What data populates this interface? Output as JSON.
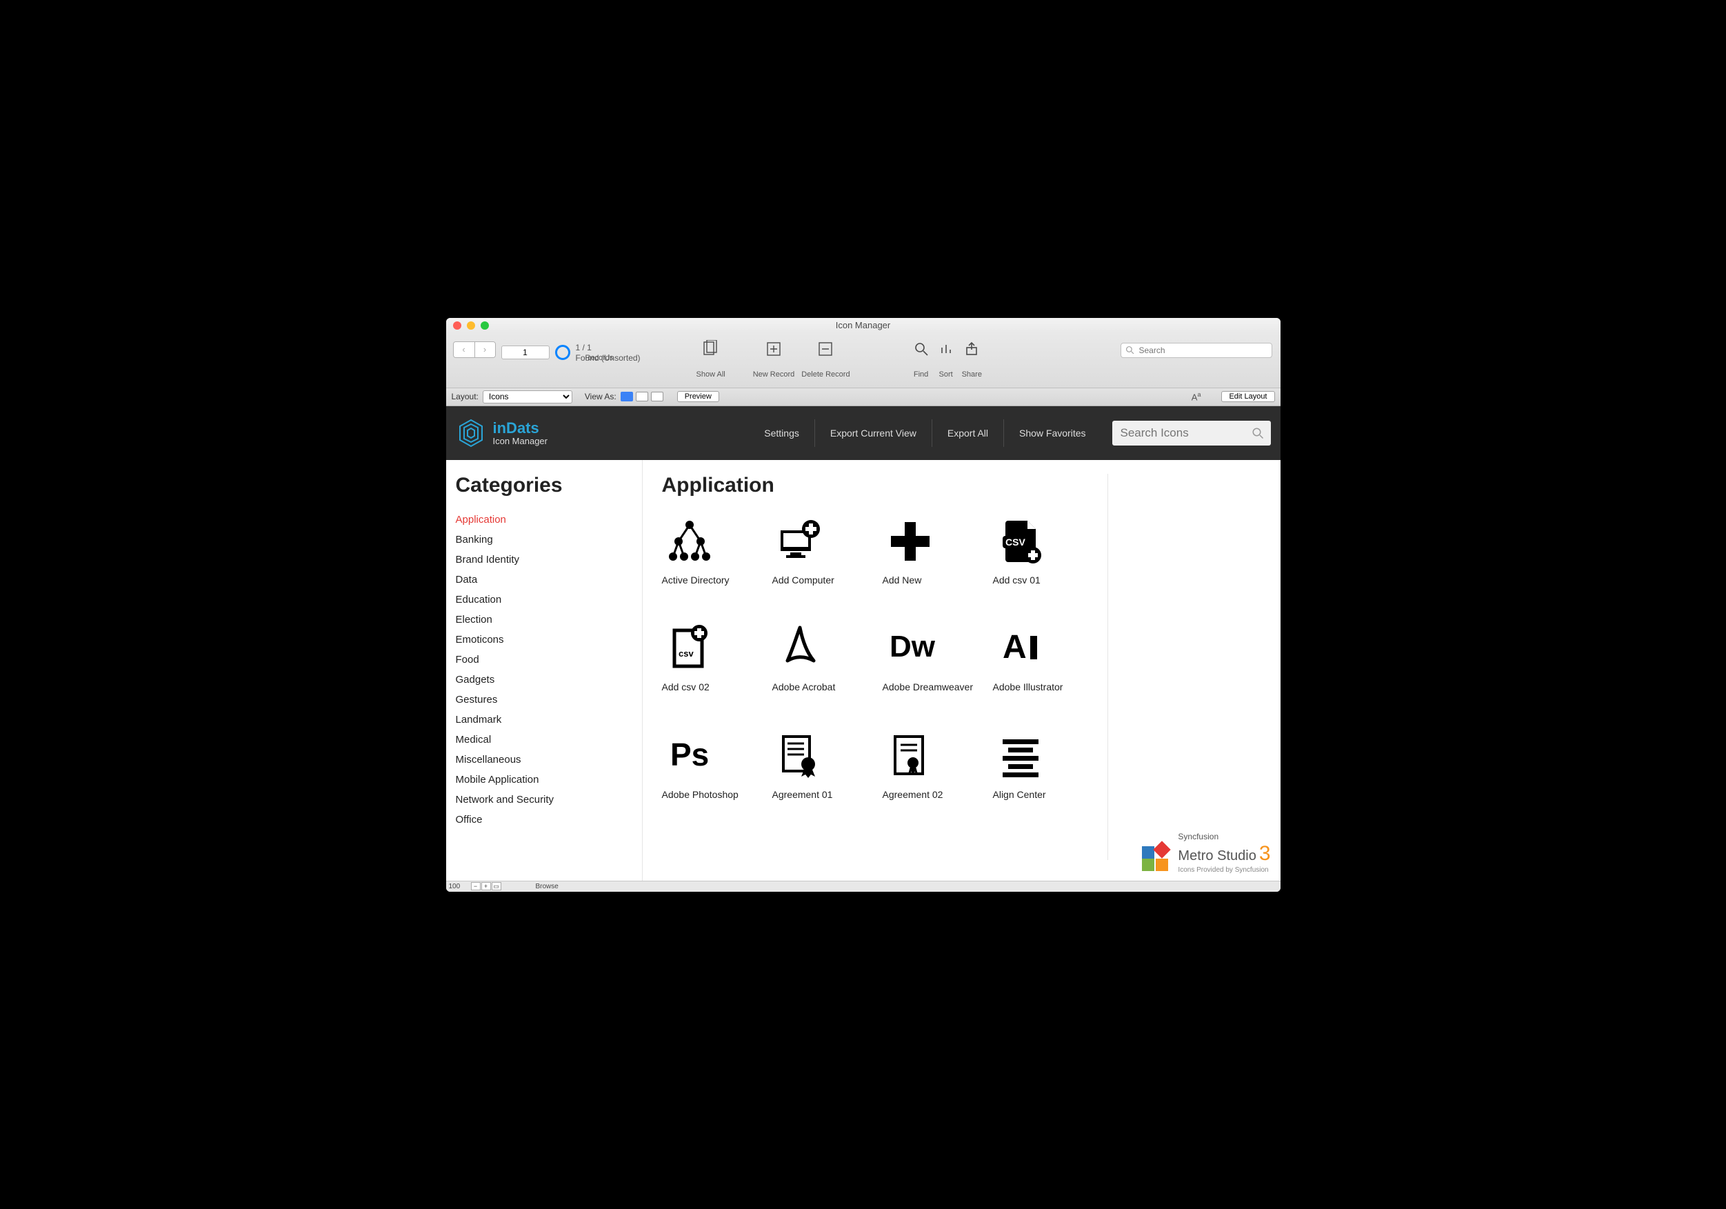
{
  "window": {
    "title": "Icon Manager"
  },
  "toolbar": {
    "record_number": "1",
    "found_count": "1 / 1",
    "found_label": "Found (Unsorted)",
    "records_label": "Records",
    "show_all": "Show All",
    "new_record": "New Record",
    "delete_record": "Delete Record",
    "find": "Find",
    "sort": "Sort",
    "share": "Share",
    "search_placeholder": "Search"
  },
  "layoutbar": {
    "layout_label": "Layout:",
    "layout_value": "Icons",
    "view_as": "View As:",
    "preview": "Preview",
    "edit_layout": "Edit Layout"
  },
  "darkbar": {
    "brand": "inDats",
    "sub": "Icon Manager",
    "links": [
      "Settings",
      "Export Current View",
      "Export All",
      "Show Favorites"
    ],
    "search_placeholder": "Search Icons"
  },
  "sidebar": {
    "heading": "Categories",
    "items": [
      "Application",
      "Banking",
      "Brand Identity",
      "Data",
      "Education",
      "Election",
      "Emoticons",
      "Food",
      "Gadgets",
      "Gestures",
      "Landmark",
      "Medical",
      "Miscellaneous",
      "Mobile Application",
      "Network and Security",
      "Office"
    ],
    "active_index": 0
  },
  "main": {
    "heading": "Application",
    "icons": [
      {
        "label": "Active Directory",
        "glyph": "tree"
      },
      {
        "label": "Add Computer",
        "glyph": "add-computer"
      },
      {
        "label": "Add New",
        "glyph": "plus"
      },
      {
        "label": "Add csv 01",
        "glyph": "csv-badge"
      },
      {
        "label": "Add csv 02",
        "glyph": "csv-page"
      },
      {
        "label": "Adobe Acrobat",
        "glyph": "acrobat"
      },
      {
        "label": "Adobe Dreamweaver",
        "glyph": "dw"
      },
      {
        "label": "Adobe Illustrator",
        "glyph": "ai"
      },
      {
        "label": "Adobe Photoshop",
        "glyph": "ps"
      },
      {
        "label": "Agreement 01",
        "glyph": "agreement1"
      },
      {
        "label": "Agreement 02",
        "glyph": "agreement2"
      },
      {
        "label": "Align Center",
        "glyph": "align-center"
      }
    ]
  },
  "branding": {
    "vendor": "Syncfusion",
    "product": "Metro Studio",
    "version": "3",
    "provided": "Icons Provided by Syncfusion"
  },
  "statusbar": {
    "zoom": "100",
    "mode": "Browse"
  }
}
